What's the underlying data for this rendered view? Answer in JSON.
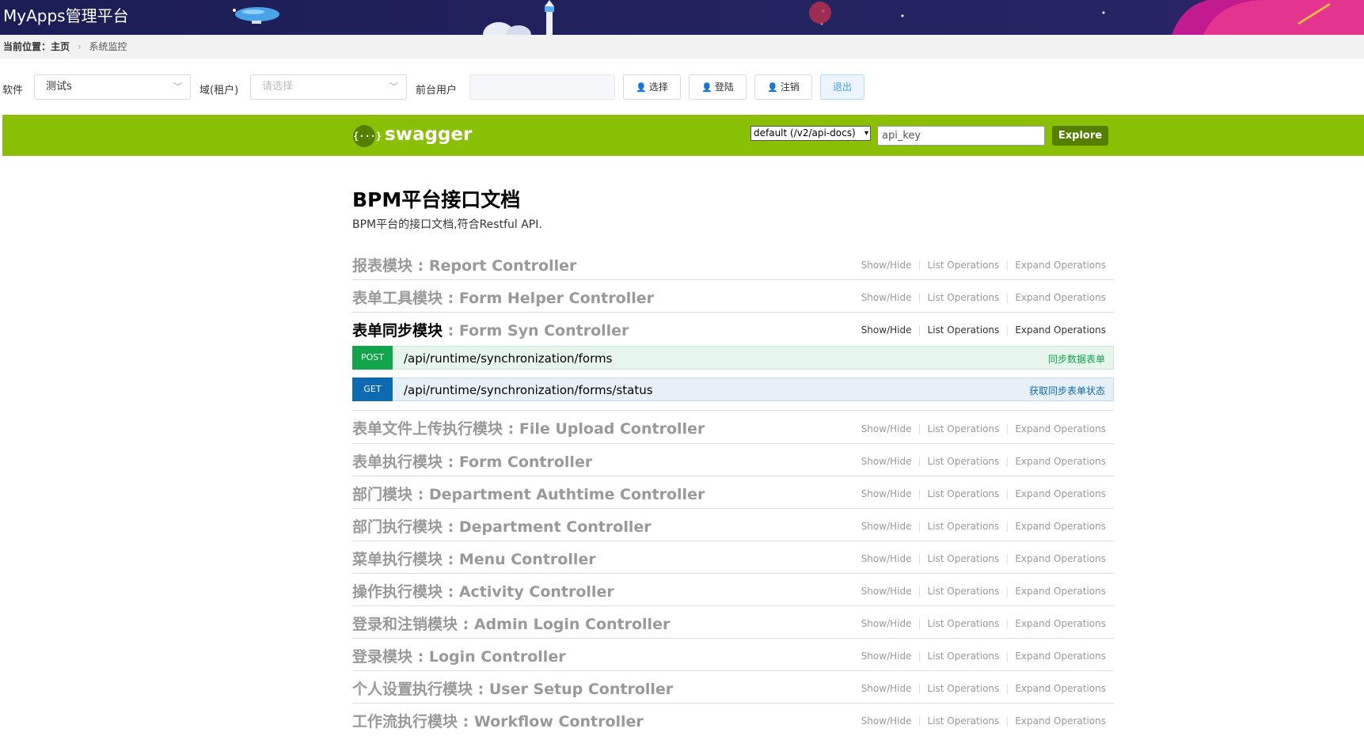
{
  "app": {
    "title": "MyApps管理平台"
  },
  "breadcrumb": {
    "label": "当前位置：主页",
    "current": "系统监控"
  },
  "toolbar": {
    "software_label": "软件",
    "software_value": "测试s",
    "domain_label": "域(租户)",
    "domain_placeholder": "请选择",
    "user_label": "前台用户",
    "user_value": "",
    "select_btn": "选择",
    "login_btn": "登陆",
    "logoff_btn": "注销",
    "logout_btn": "退出"
  },
  "swagger": {
    "brand": "swagger",
    "logo_glyph": "{···}",
    "spec_select": "default (/v2/api-docs)",
    "api_key_placeholder": "api_key",
    "explore": "Explore",
    "brand_color": "#89bf04"
  },
  "doc": {
    "title": "BPM平台接口文档",
    "description": "BPM平台的接口文档,符合Restful API."
  },
  "links": {
    "show_hide": "Show/Hide",
    "list_ops": "List Operations",
    "expand_ops": "Expand Operations"
  },
  "resources": [
    {
      "zh": "报表模块",
      "en": " : Report Controller"
    },
    {
      "zh": "表单工具模块",
      "en": " : Form Helper Controller"
    },
    {
      "zh": "表单同步模块",
      "en": " : Form Syn Controller"
    },
    {
      "zh": "表单文件上传执行模块",
      "en": " : File Upload Controller"
    },
    {
      "zh": "表单执行模块",
      "en": " : Form Controller"
    },
    {
      "zh": "部门模块",
      "en": " : Department Authtime Controller"
    },
    {
      "zh": "部门执行模块",
      "en": " : Department Controller"
    },
    {
      "zh": "菜单执行模块",
      "en": " : Menu Controller"
    },
    {
      "zh": "操作执行模块",
      "en": " : Activity Controller"
    },
    {
      "zh": "登录和注销模块",
      "en": " : Admin Login Controller"
    },
    {
      "zh": "登录模块",
      "en": " : Login Controller"
    },
    {
      "zh": "个人设置执行模块",
      "en": " : User Setup Controller"
    },
    {
      "zh": "工作流执行模块",
      "en": " : Workflow Controller"
    }
  ],
  "operations": [
    {
      "method": "POST",
      "path": "/api/runtime/synchronization/forms",
      "summary": "同步数据表单"
    },
    {
      "method": "GET",
      "path": "/api/runtime/synchronization/forms/status",
      "summary": "获取同步表单状态"
    }
  ]
}
